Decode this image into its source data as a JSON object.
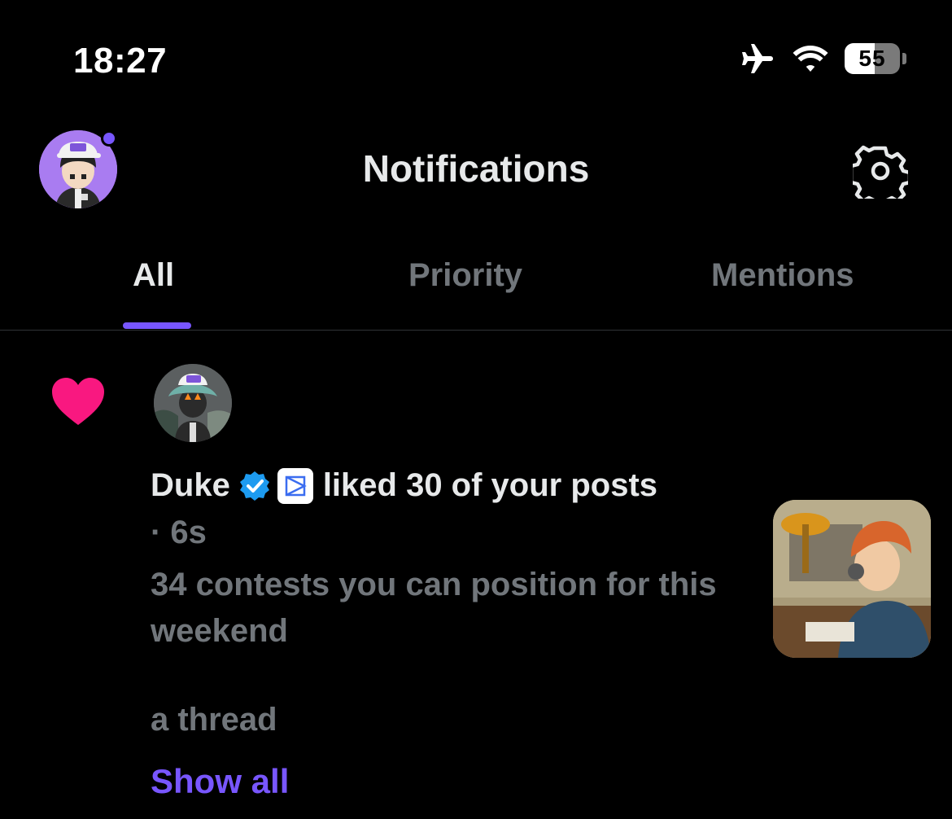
{
  "status_bar": {
    "time": "18:27",
    "battery_level": "55",
    "battery_fraction": 0.55,
    "icons": [
      "airplane-icon",
      "wifi-icon",
      "battery-icon"
    ]
  },
  "header": {
    "title": "Notifications"
  },
  "tabs": [
    {
      "label": "All",
      "active": true
    },
    {
      "label": "Priority",
      "active": false
    },
    {
      "label": "Mentions",
      "active": false
    }
  ],
  "notification": {
    "type_icon": "heart-icon",
    "user_name": "Duke",
    "action": "liked 30 of your posts",
    "time": "· 6s",
    "text": "34 contests you can position for this weekend",
    "text2": "a thread",
    "show_all": "Show all"
  },
  "colors": {
    "accent": "#7856ff",
    "heart": "#f91880",
    "verified": "#1d9bf0",
    "muted_text": "#71767b",
    "primary_text": "#e7e9ea"
  }
}
